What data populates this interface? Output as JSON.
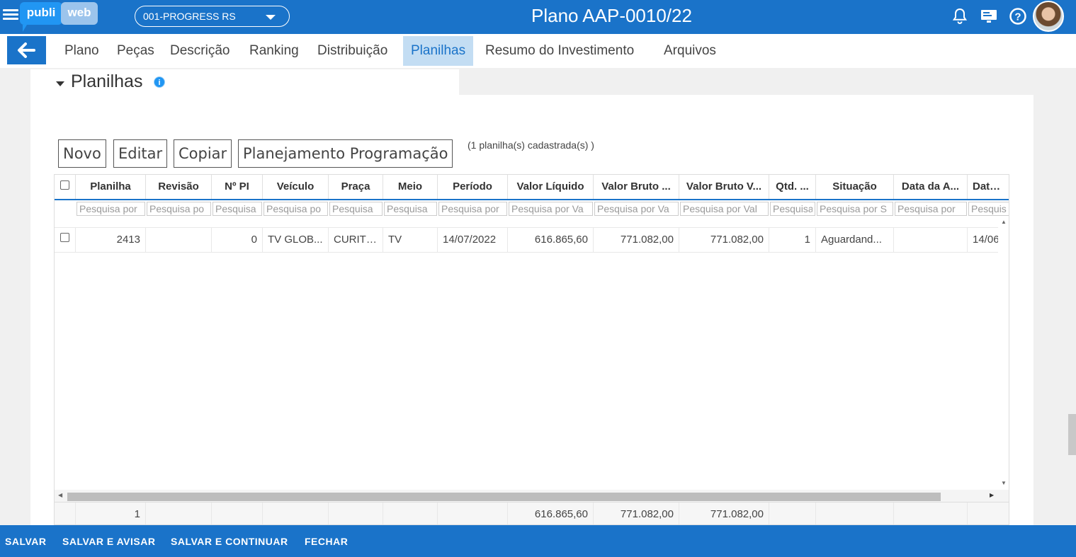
{
  "header": {
    "logo_part1": "publi",
    "logo_part2": "web",
    "client_selector": "001-PROGRESS RS",
    "title": "Plano AAP-0010/22",
    "icons": [
      "bell-icon",
      "monitor-icon",
      "help-icon",
      "avatar"
    ],
    "accent": "#1a73c9"
  },
  "tabs": [
    {
      "label": "Plano"
    },
    {
      "label": "Peças"
    },
    {
      "label": "Descrição"
    },
    {
      "label": "Ranking"
    },
    {
      "label": "Distribuição"
    },
    {
      "label": "Planilhas",
      "active": true
    },
    {
      "label": "Resumo do Investimento"
    },
    {
      "label": "Arquivos"
    }
  ],
  "section": {
    "title": "Planilhas",
    "info_icon": "i"
  },
  "toolbar": {
    "new_label": "Novo",
    "edit_label": "Editar",
    "copy_label": "Copiar",
    "plan_label": "Planejamento Programação",
    "count_text": "(1   planilha(s) cadastrada(s) )"
  },
  "grid": {
    "columns": [
      "Planilha",
      "Revisão",
      "Nº PI",
      "Veículo",
      "Praça",
      "Meio",
      "Período",
      "Valor Líquido",
      "Valor Bruto ...",
      "Valor Bruto V...",
      "Qtd. ...",
      "Situação",
      "Data da A...",
      "Data Al"
    ],
    "filters": [
      "Pesquisa por",
      "Pesquisa po",
      "Pesquisa",
      "Pesquisa po",
      "Pesquisa",
      "Pesquisa",
      "Pesquisa por",
      "Pesquisa por Va",
      "Pesquisa por Va",
      "Pesquisa por Val",
      "Pesquisa",
      "Pesquisa por S",
      "Pesquisa por",
      "Pesquis"
    ],
    "rows": [
      [
        "2413",
        "",
        "0",
        "TV GLOB...",
        "CURITI...",
        "TV",
        "14/07/2022",
        "616.865,60",
        "771.082,00",
        "771.082,00",
        "1",
        "Aguardand...",
        "",
        "14/06"
      ]
    ],
    "totals": [
      "1",
      "",
      "",
      "",
      "",
      "",
      "",
      "616.865,60",
      "771.082,00",
      "771.082,00",
      "",
      "",
      "",
      ""
    ]
  },
  "footer": {
    "save": "SALVAR",
    "save_notify": "SALVAR E AVISAR",
    "save_continue": "SALVAR E CONTINUAR",
    "close": "FECHAR"
  }
}
